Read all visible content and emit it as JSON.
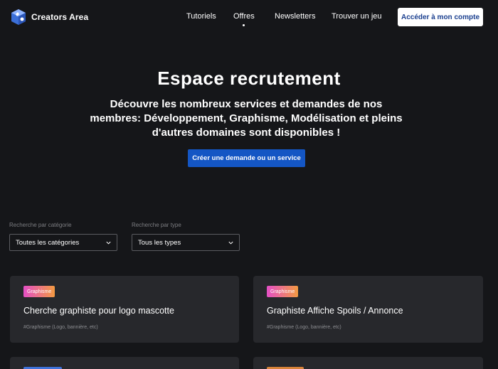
{
  "brand": {
    "name": "Creators Area"
  },
  "nav": {
    "items": [
      {
        "label": "Tutoriels"
      },
      {
        "label": "Offres",
        "active": true
      },
      {
        "label": "Newsletters"
      },
      {
        "label": "Trouver un jeu"
      }
    ],
    "account_button": "Accéder à mon compte"
  },
  "hero": {
    "title": "Espace recrutement",
    "subtitle": "Découvre les nombreux services et demandes de nos membres: Développement, Graphisme, Modélisation et pleins d'autres domaines sont disponibles !",
    "cta": "Créer une demande ou un service"
  },
  "filters": {
    "category": {
      "label": "Recherche par catégorie",
      "value": "Toutes les catégories"
    },
    "type": {
      "label": "Recherche par type",
      "value": "Tous les types"
    }
  },
  "cards": [
    {
      "badge": "Graphisme",
      "title": "Cherche graphiste pour logo mascotte",
      "tag": "#Graphisme (Logo, bannière, etc)"
    },
    {
      "badge": "Graphisme",
      "title": "Graphiste Affiche Spoils / Annonce",
      "tag": "#Graphisme (Logo, bannière, etc)"
    },
    {
      "badge_color": "#3f72d9"
    },
    {
      "badge_color": "#d9843a"
    }
  ],
  "colors": {
    "background": "#151619",
    "card": "#27282c",
    "accent": "#1456c4",
    "badge_gradient_start": "#e44fc6",
    "badge_gradient_end": "#f39a41"
  }
}
